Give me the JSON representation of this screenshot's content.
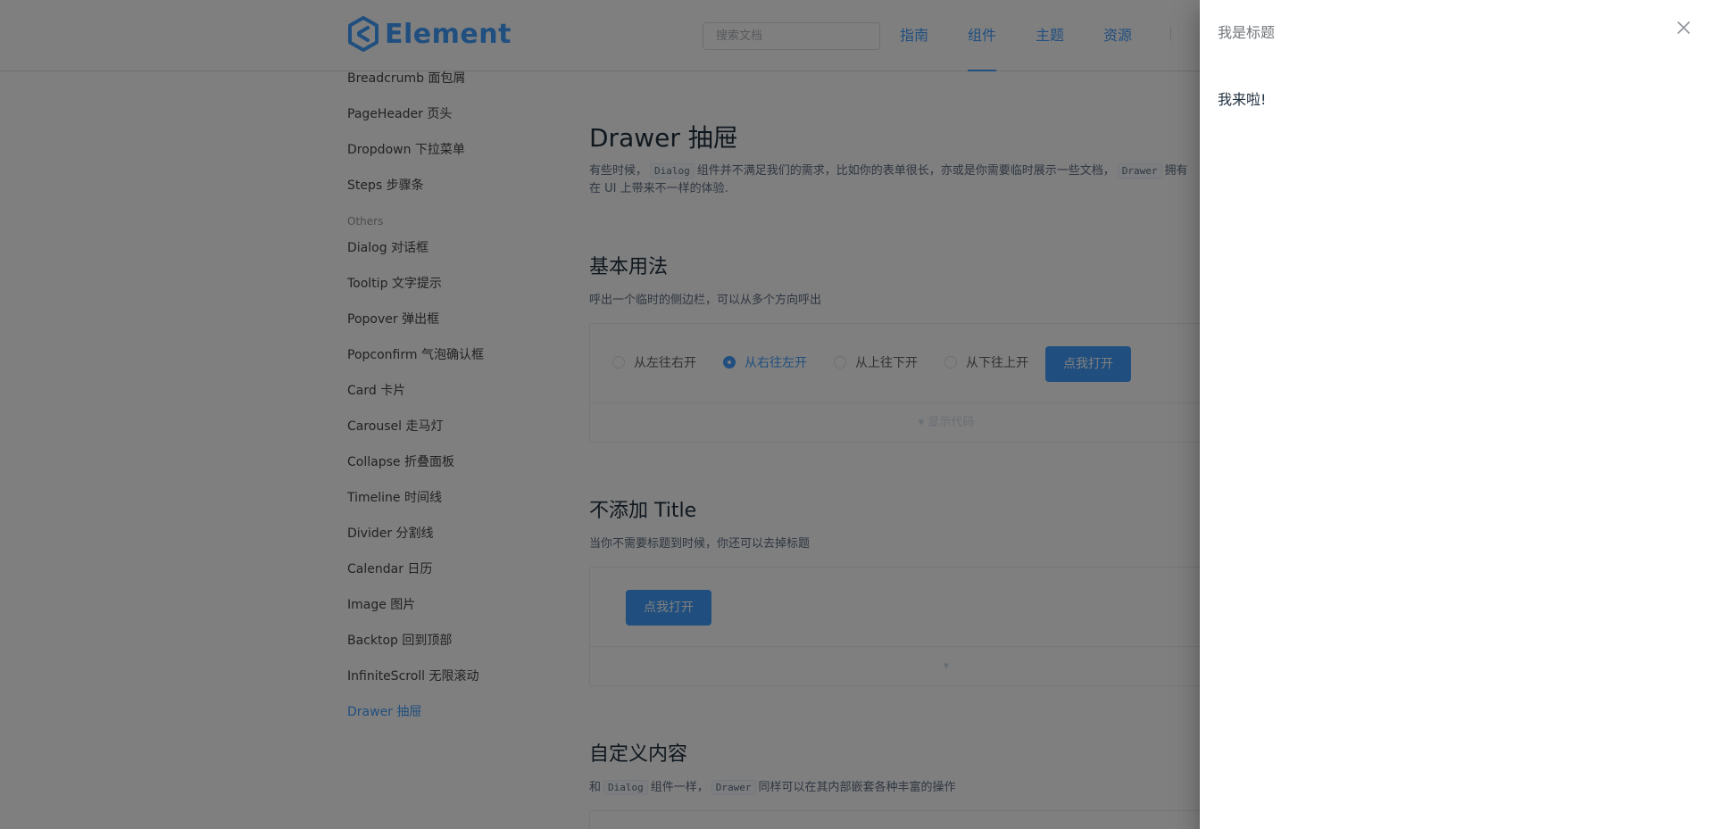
{
  "header": {
    "logo_text": "Element",
    "search_placeholder": "搜索文档",
    "nav": [
      "指南",
      "组件",
      "主题",
      "资源"
    ],
    "active_nav": "组件"
  },
  "sidebar": {
    "items_before": [
      "Breadcrumb 面包屑",
      "PageHeader 页头",
      "Dropdown 下拉菜单",
      "Steps 步骤条"
    ],
    "group_label": "Others",
    "items_after": [
      "Dialog 对话框",
      "Tooltip 文字提示",
      "Popover 弹出框",
      "Popconfirm 气泡确认框",
      "Card 卡片",
      "Carousel 走马灯",
      "Collapse 折叠面板",
      "Timeline 时间线",
      "Divider 分割线",
      "Calendar 日历",
      "Image 图片",
      "Backtop 回到顶部",
      "InfiniteScroll 无限滚动",
      "Drawer 抽屉"
    ],
    "active_item": "Drawer 抽屉"
  },
  "main": {
    "title": "Drawer 抽屉",
    "intro_line1_a": "有些时候，",
    "intro_code1": "Dialog",
    "intro_line1_b": "组件并不满足我们的需求，比如你的表单很长，亦或是你需要临时展示一些文档，",
    "intro_code2": "Drawer",
    "intro_line1_c": "拥有",
    "intro_line2": "在 UI 上带来不一样的体验.",
    "section1_title": "基本用法",
    "section1_desc": "呼出一个临时的侧边栏，可以从多个方向呼出",
    "radios": [
      "从左往右开",
      "从右往左开",
      "从上往下开",
      "从下往上开"
    ],
    "radio_checked": "从右往左开",
    "open_button": "点我打开",
    "show_code": "显示代码",
    "section2_title": "不添加 Title",
    "section2_desc": "当你不需要标题到时候，你还可以去掉标题",
    "open_button2": "点我打开",
    "section3_title": "自定义内容",
    "section3_desc_a": "和",
    "section3_code1": "Dialog",
    "section3_desc_b": "组件一样，",
    "section3_code2": "Drawer",
    "section3_desc_c": "同样可以在其内部嵌套各种丰富的操作"
  },
  "drawer": {
    "title": "我是标题",
    "body": "我来啦!"
  },
  "colors": {
    "primary": "#409eff",
    "overlay": "rgba(0,0,0,0.5)"
  },
  "icons": {
    "logo": "element-logo-icon",
    "close": "close-icon",
    "caret": "caret-down-icon"
  }
}
